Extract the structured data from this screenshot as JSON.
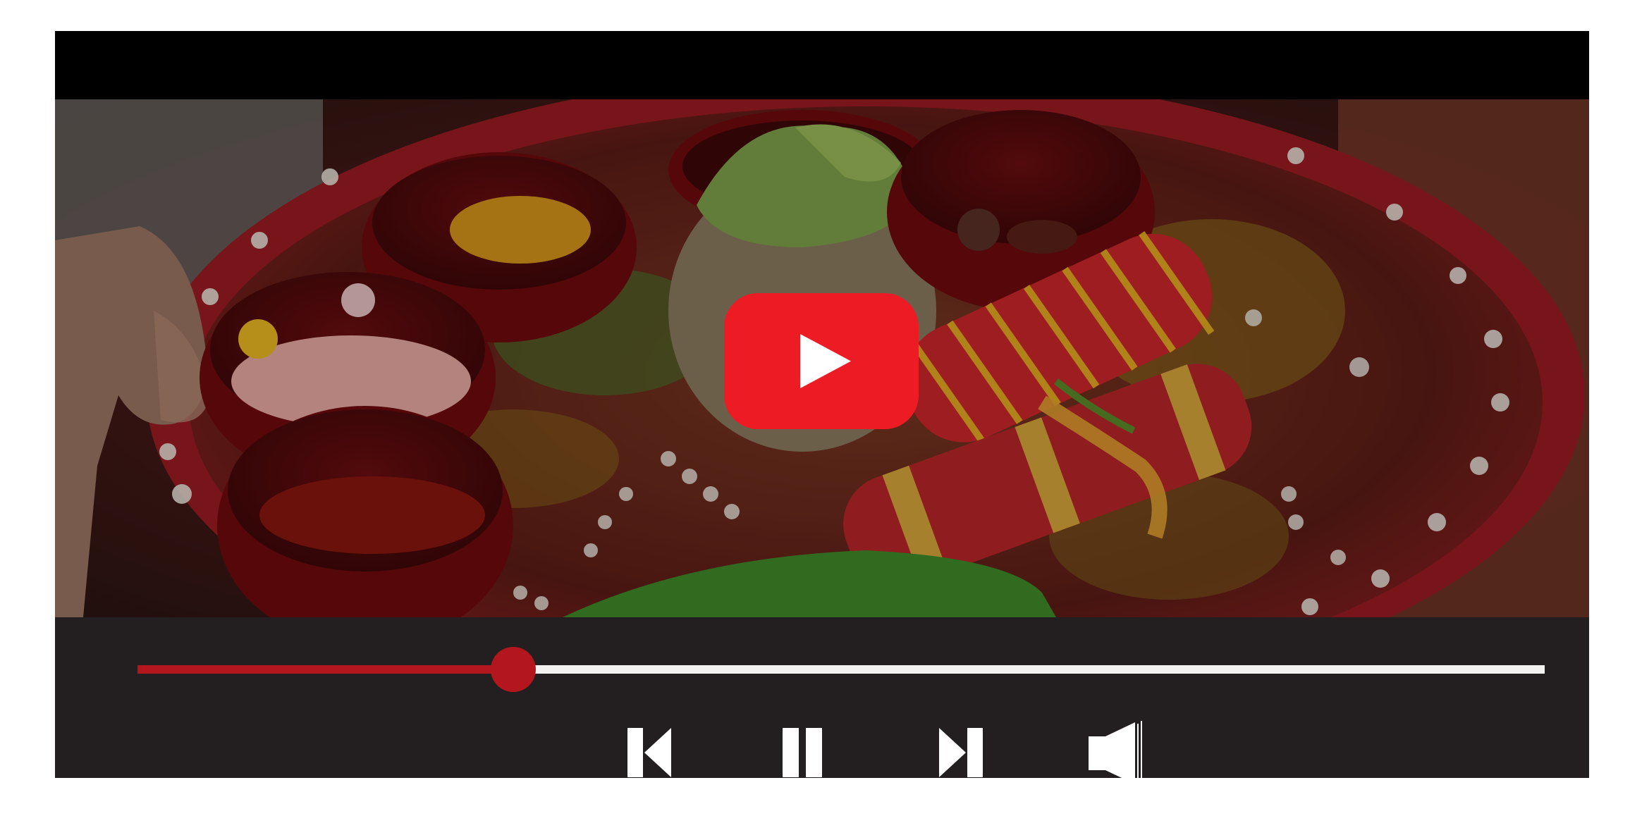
{
  "player": {
    "progress_fraction": 0.267,
    "colors": {
      "played": "#b3161c",
      "track": "#f4f1f1",
      "control_bar": "#231f20",
      "play_button": "#ed1c24"
    }
  },
  "controls": {
    "icons": [
      "skip-previous-icon",
      "pause-icon",
      "skip-next-icon",
      "volume-icon"
    ]
  }
}
